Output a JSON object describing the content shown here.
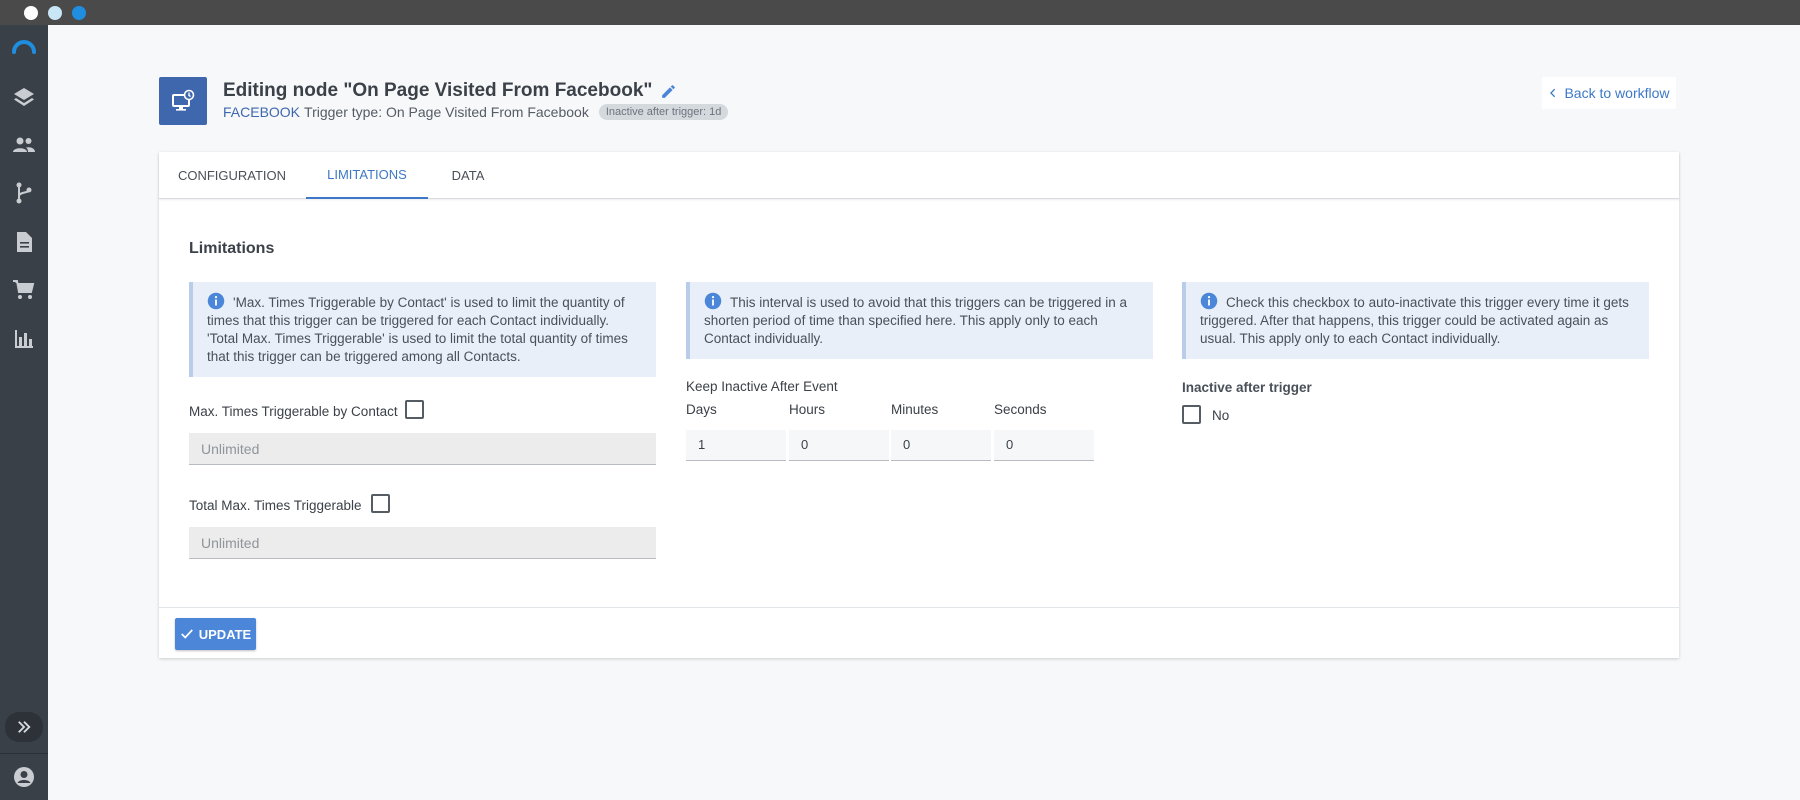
{
  "header": {
    "title": "Editing node \"On Page Visited From Facebook\"",
    "provider": "FACEBOOK",
    "trigger_type": "Trigger type: On Page Visited From Facebook",
    "badge": "Inactive after trigger: 1d",
    "back_label": "Back to workflow"
  },
  "tabs": [
    {
      "label": "CONFIGURATION"
    },
    {
      "label": "LIMITATIONS"
    },
    {
      "label": "DATA"
    }
  ],
  "section_title": "Limitations",
  "col1": {
    "info": "'Max. Times Triggerable by Contact' is used to limit the quantity of times that this trigger can be triggered for each Contact individually. 'Total Max. Times Triggerable' is used to limit the total quantity of times that this trigger can be triggered among all Contacts.",
    "max_contact_label": "Max. Times Triggerable by Contact",
    "max_contact_placeholder": "Unlimited",
    "total_max_label": "Total Max. Times Triggerable",
    "total_max_placeholder": "Unlimited"
  },
  "col2": {
    "info": "This interval is used to avoid that this triggers can be triggered in a shorten period of time than specified here. This apply only to each Contact individually.",
    "keep_inactive_label": "Keep Inactive After Event",
    "units": [
      "Days",
      "Hours",
      "Minutes",
      "Seconds"
    ],
    "values": [
      "1",
      "0",
      "0",
      "0"
    ]
  },
  "col3": {
    "info": "Check this checkbox to auto-inactivate this trigger every time it gets triggered. After that happens, this trigger could be activated again as usual. This apply only to each Contact individually.",
    "inactive_label": "Inactive after trigger",
    "checkbox_label": "No"
  },
  "footer": {
    "update_label": "UPDATE"
  },
  "colors": {
    "accent": "#3d78c8",
    "sidebar": "#394047",
    "node_icon": "#3e67ad",
    "info_bg": "#e8eff9"
  }
}
